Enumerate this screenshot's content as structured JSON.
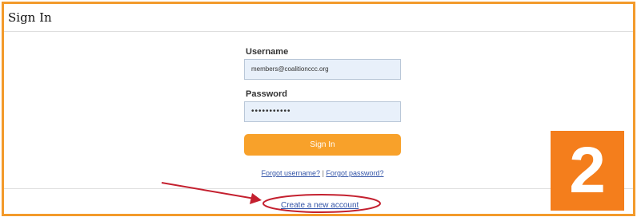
{
  "page": {
    "title": "Sign In"
  },
  "form": {
    "username_label": "Username",
    "username_value": "members@coalitionccc.org",
    "password_label": "Password",
    "password_value": "•••••••••••",
    "submit_label": "Sign In"
  },
  "links": {
    "forgot_username": "Forgot username?",
    "separator": "|",
    "forgot_password": "Forgot password?",
    "create_account": "Create a new account"
  },
  "annotation": {
    "step_number": "2"
  },
  "colors": {
    "accent": "#f8a12a",
    "border": "#f39a2b",
    "badge": "#f47e1c",
    "annotation": "#c4202f",
    "link": "#3455a8",
    "input_bg": "#e8f0fa"
  }
}
